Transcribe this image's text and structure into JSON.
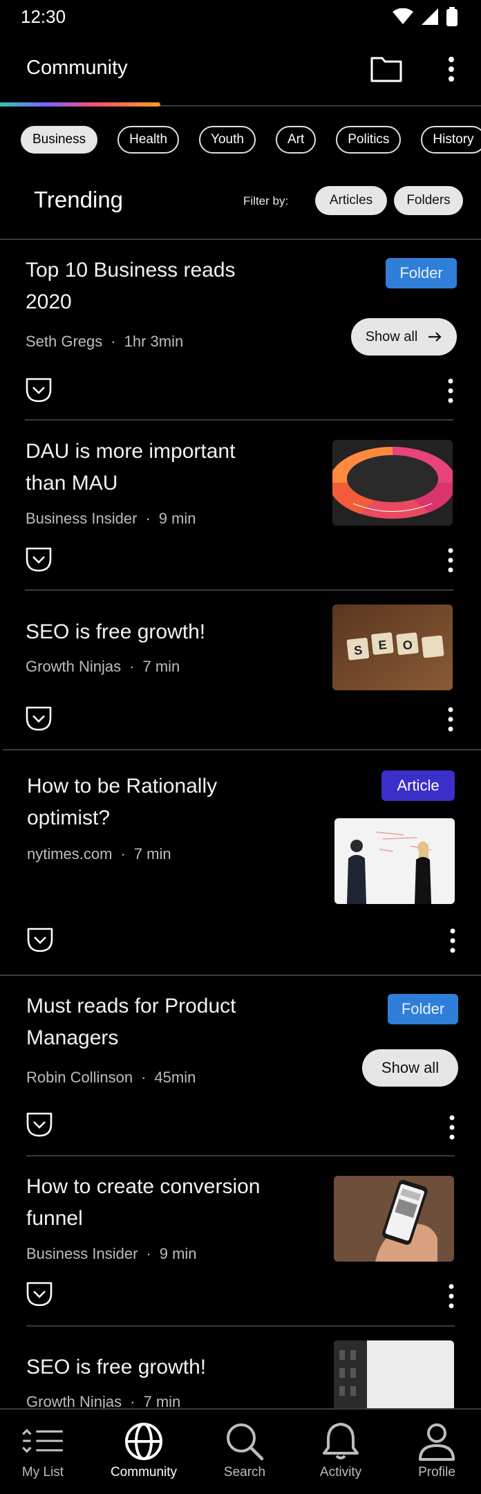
{
  "status_bar": {
    "time": "12:30"
  },
  "app_bar": {
    "title": "Community"
  },
  "categories": [
    "Business",
    "Health",
    "Youth",
    "Art",
    "Politics",
    "History"
  ],
  "trending": {
    "title": "Trending",
    "filter_label": "Filter by:",
    "filters": [
      "Articles",
      "Folders"
    ]
  },
  "cards": [
    {
      "title_lines": [
        "Top 10 Business reads",
        "2020"
      ],
      "source": "Seth Gregs",
      "duration": "1hr 3min",
      "badge": "Folder",
      "action": "Show all"
    },
    {
      "title_lines": [
        "DAU is more important",
        "than MAU"
      ],
      "source": "Business Insider",
      "duration": "9 min",
      "thumb": "wheel-chart"
    },
    {
      "title_lines": [
        "SEO is free growth!"
      ],
      "source": "Growth Ninjas",
      "duration": "7 min",
      "thumb": "seo-tiles"
    },
    {
      "title_lines": [
        "How to be Rationally",
        "optimist?"
      ],
      "source": "nytimes.com",
      "duration": "7 min",
      "badge": "Article",
      "thumb": "whiteboard-meeting"
    },
    {
      "title_lines": [
        "Must reads for Product",
        "Managers"
      ],
      "source": "Robin Collinson",
      "duration": "45min",
      "badge": "Folder",
      "action": "Show all"
    },
    {
      "title_lines": [
        "How to create conversion",
        "funnel"
      ],
      "source": "Business Insider",
      "duration": "9 min",
      "thumb": "phone-in-hand"
    },
    {
      "title_lines": [
        "SEO is free growth!"
      ],
      "source": "Growth Ninjas",
      "duration": "7 min",
      "thumb": "building"
    }
  ],
  "bottom_nav": [
    {
      "label": "My List",
      "icon": "list-icon"
    },
    {
      "label": "Community",
      "icon": "globe-icon",
      "active": true
    },
    {
      "label": "Search",
      "icon": "search-icon"
    },
    {
      "label": "Activity",
      "icon": "bell-icon"
    },
    {
      "label": "Profile",
      "icon": "person-icon"
    }
  ],
  "colors": {
    "background": "#000000",
    "chip_active": "#e6e6e6",
    "folder_badge": "#2f7fd8",
    "article_badge": "#3b2fc9",
    "divider": "#3a3a3a"
  }
}
